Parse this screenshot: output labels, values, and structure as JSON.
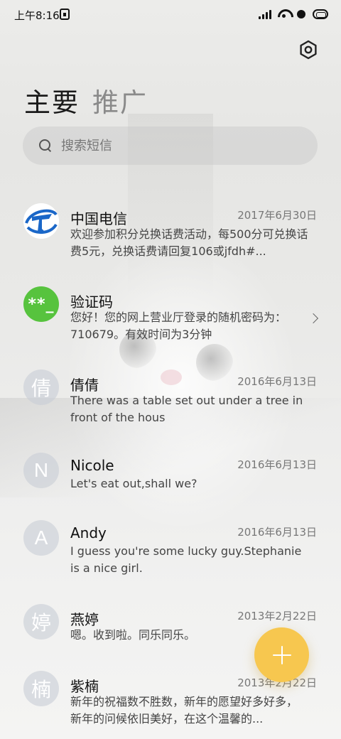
{
  "status_bar": {
    "time": "上午8:16"
  },
  "header": {
    "tabs": [
      {
        "label": "主要",
        "active": true
      },
      {
        "label": "推广",
        "active": false
      }
    ]
  },
  "search": {
    "placeholder": "搜索短信"
  },
  "conversations": [
    {
      "name": "中国电信",
      "date": "2017年6月30日",
      "preview": "欢迎参加积分兑换话费活动，每500分可兑换话费5元，兑换话费请回复106或jfdh#...",
      "avatar": "telecom-logo"
    },
    {
      "name": "验证码",
      "date": "",
      "preview": "您好！您的网上营业厅登录的随机密码为：710679。有效时间为3分钟",
      "avatar_text": "**_"
    },
    {
      "name": "倩倩",
      "date": "2016年6月13日",
      "preview": "There was a table set out under a tree in front of the hous",
      "avatar_text": "倩"
    },
    {
      "name": "Nicole",
      "date": "2016年6月13日",
      "preview": "Let's eat out,shall we?",
      "avatar_text": "N"
    },
    {
      "name": "Andy",
      "date": "2016年6月13日",
      "preview": "I guess you're some lucky guy.Stephanie is a nice girl.",
      "avatar_text": "A"
    },
    {
      "name": "燕婷",
      "date": "2013年2月22日",
      "preview": "嗯。收到啦。同乐同乐。",
      "avatar_text": "婷"
    },
    {
      "name": "紫楠",
      "date": "2013年2月22日",
      "preview": "新年的祝福数不胜数，新年的愿望好多好多，新年的问候依旧美好，在这个温馨的...",
      "avatar_text": "楠"
    }
  ],
  "colors": {
    "fab": "#f7c74f",
    "verification_avatar": "#57c33e",
    "telecom_blue": "#1a67c8"
  }
}
